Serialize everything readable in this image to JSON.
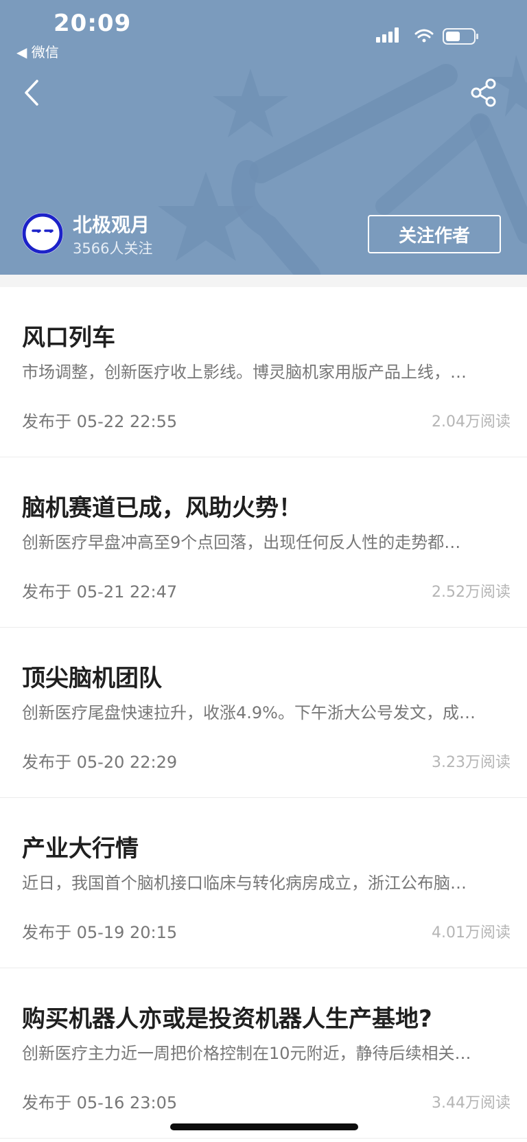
{
  "status_bar": {
    "time": "20:09",
    "back_app": "◀ 微信"
  },
  "header": {
    "background_color": "#7b9bbd",
    "back_icon": "chevron-left-icon",
    "share_icon": "share-icon"
  },
  "author": {
    "name": "北极观月",
    "followers": "3566人关注",
    "follow_label": "关注作者"
  },
  "articles": [
    {
      "title": "风口列车",
      "summary": "市场调整，创新医疗收上影线。博灵脑机家用版产品上线，…",
      "date": "发布于 05-22 22:55",
      "reads": "2.04万阅读"
    },
    {
      "title": "脑机赛道已成，风助火势！",
      "summary": "创新医疗早盘冲高至9个点回落，出现任何反人性的走势都…",
      "date": "发布于 05-21 22:47",
      "reads": "2.52万阅读"
    },
    {
      "title": "顶尖脑机团队",
      "summary": "创新医疗尾盘快速拉升，收涨4.9%。下午浙大公号发文，成…",
      "date": "发布于 05-20 22:29",
      "reads": "3.23万阅读"
    },
    {
      "title": "产业大行情",
      "summary": "近日，我国首个脑机接口临床与转化病房成立，浙江公布脑…",
      "date": "发布于 05-19 20:15",
      "reads": "4.01万阅读"
    },
    {
      "title": "购买机器人亦或是投资机器人生产基地?",
      "summary": "创新医疗主力近一周把价格控制在10元附近，静待后续相关…",
      "date": "发布于 05-16 23:05",
      "reads": "3.44万阅读"
    }
  ]
}
